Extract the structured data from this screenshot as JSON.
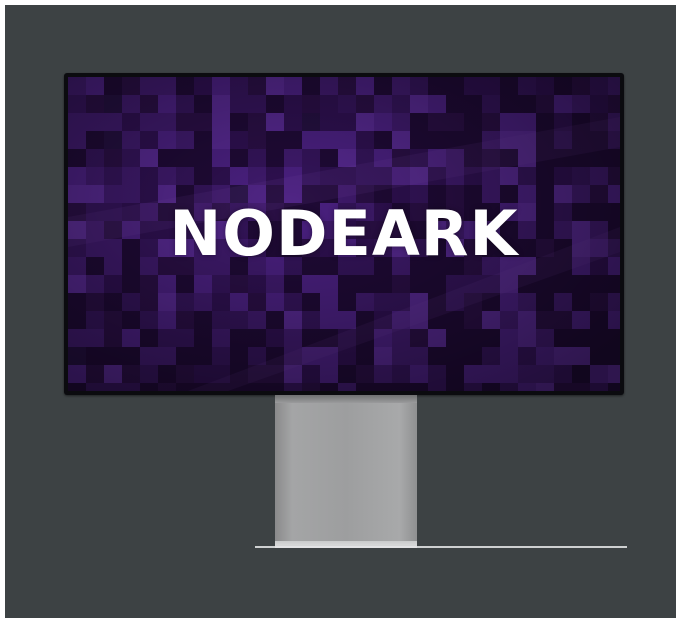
{
  "screen": {
    "brand_text": "NODEARK",
    "background_color": "#2a0f45",
    "accent_color": "#5b2a8c",
    "text_color": "#ffffff"
  },
  "scene": {
    "backdrop_color": "#3d4244",
    "stand_color": "#9d9e9f"
  }
}
